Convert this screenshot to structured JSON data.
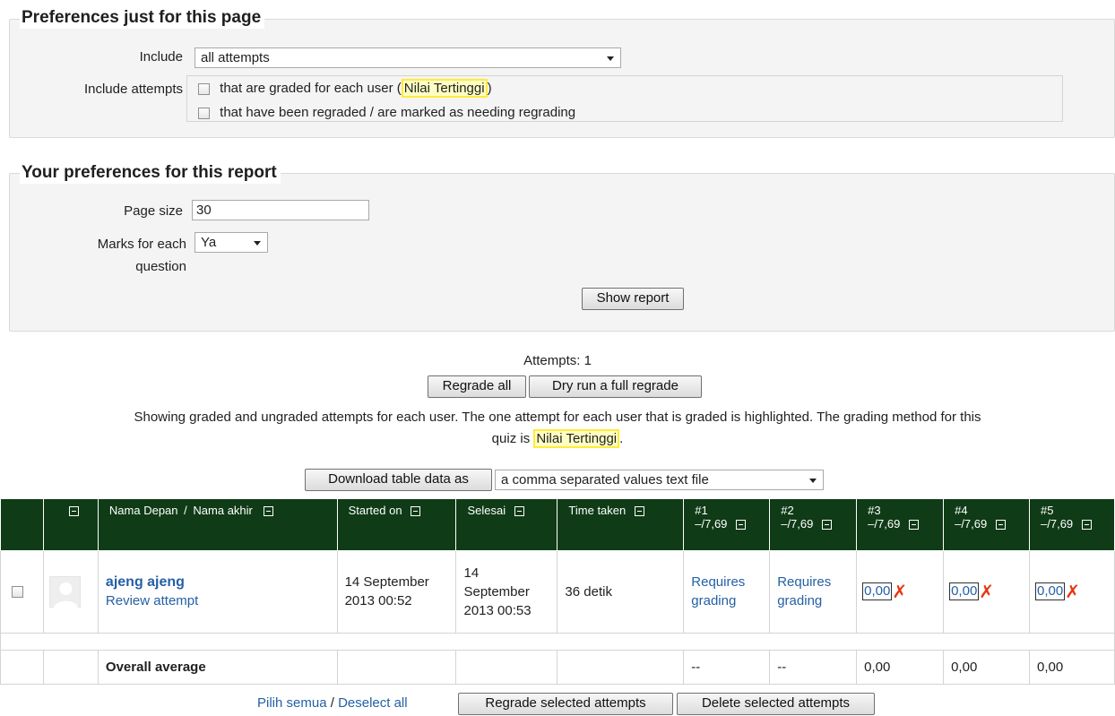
{
  "preferences_page": {
    "legend": "Preferences just for this page",
    "include_label": "Include",
    "include_value": "all attempts",
    "include_attempts_label": "Include attempts",
    "option_graded_prefix": "that are graded for each user (",
    "option_graded_method": "Nilai Tertinggi",
    "option_graded_suffix": ")",
    "option_regraded": "that have been regraded / are marked as needing regrading"
  },
  "preferences_report": {
    "legend": "Your preferences for this report",
    "page_size_label": "Page size",
    "page_size_value": "30",
    "marks_label_line1": "Marks for each",
    "marks_label_line2": "question",
    "marks_value": "Ya",
    "show_report_button": "Show report"
  },
  "summary": {
    "attempts": "Attempts: 1",
    "regrade_all_button": "Regrade all",
    "dry_run_button": "Dry run a full regrade",
    "info_line1": "Showing graded and ungraded attempts for each user. The one attempt for each user that is graded is highlighted. The grading method for this",
    "info_line2_prefix": "quiz is",
    "info_method": "Nilai Tertinggi",
    "info_line2_suffix": "."
  },
  "download": {
    "button": "Download table data as",
    "format_value": "a comma separated values text file"
  },
  "table": {
    "headers": {
      "name_first": "Nama Depan",
      "name_sep": "/",
      "name_last": "Nama akhir",
      "started": "Started on",
      "finished": "Selesai",
      "time_taken": "Time taken",
      "q1": "#1",
      "q2": "#2",
      "q3": "#3",
      "q4": "#4",
      "q5": "#5",
      "q_max": "–/7,69"
    },
    "row": {
      "name": "ajeng ajeng",
      "review": "Review attempt",
      "started_line1": "14 September",
      "started_line2": "2013 00:52",
      "finished_line1": "14",
      "finished_line2": "September",
      "finished_line3": "2013 00:53",
      "time_taken": "36 detik",
      "q1_line1": "Requires",
      "q1_line2": "grading",
      "q2_line1": "Requires",
      "q2_line2": "grading",
      "q3": "0,00",
      "q4": "0,00",
      "q5": "0,00"
    },
    "average": {
      "label": "Overall average",
      "q1": "--",
      "q2": "--",
      "q3": "0,00",
      "q4": "0,00",
      "q5": "0,00"
    }
  },
  "footer": {
    "select_all": "Pilih semua",
    "sep": "/",
    "deselect_all": "Deselect all",
    "regrade_selected": "Regrade selected attempts",
    "delete_selected": "Delete selected attempts"
  },
  "colors": {
    "header_bg": "#0f3b17",
    "link": "#2560a5",
    "highlight_border": "#ffeb3b",
    "incorrect_mark": "#e8350f"
  }
}
